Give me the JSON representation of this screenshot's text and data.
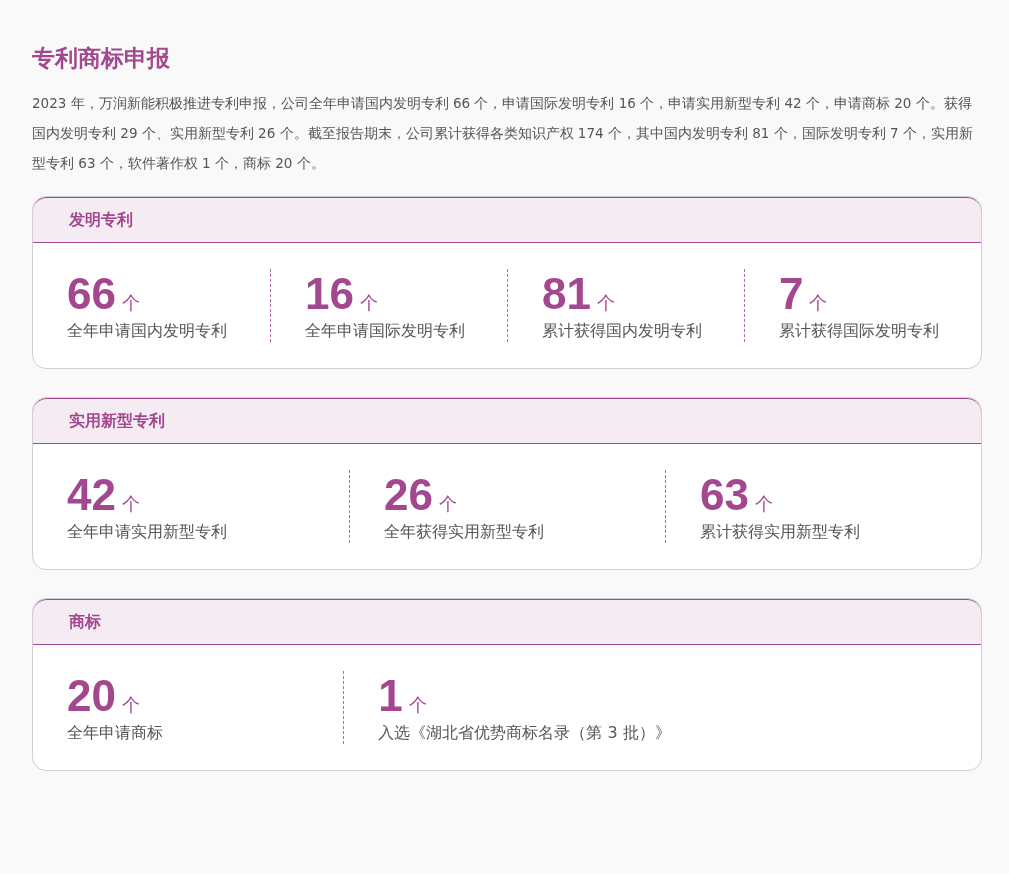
{
  "title": "专利商标申报",
  "intro": "2023 年，万润新能积极推进专利申报，公司全年申请国内发明专利 66 个，申请国际发明专利 16 个，申请实用新型专利 42 个，申请商标 20 个。获得国内发明专利 29 个、实用新型专利 26 个。截至报告期末，公司累计获得各类知识产权 174 个，其中国内发明专利 81 个，国际发明专利 7 个，实用新型专利 63 个，软件著作权 1 个，商标 20 个。",
  "sections": [
    {
      "title": "发明专利",
      "stats": [
        {
          "value": "66",
          "unit": "个",
          "label": "全年申请国内发明专利"
        },
        {
          "value": "16",
          "unit": "个",
          "label": "全年申请国际发明专利"
        },
        {
          "value": "81",
          "unit": "个",
          "label": "累计获得国内发明专利"
        },
        {
          "value": "7",
          "unit": "个",
          "label": "累计获得国际发明专利"
        }
      ]
    },
    {
      "title": "实用新型专利",
      "stats": [
        {
          "value": "42",
          "unit": "个",
          "label": "全年申请实用新型专利"
        },
        {
          "value": "26",
          "unit": "个",
          "label": "全年获得实用新型专利"
        },
        {
          "value": "63",
          "unit": "个",
          "label": "累计获得实用新型专利"
        }
      ]
    },
    {
      "title": "商标",
      "stats": [
        {
          "value": "20",
          "unit": "个",
          "label": "全年申请商标"
        },
        {
          "value": "1",
          "unit": "个",
          "label": "入选《湖北省优势商标名录（第 3 批）》"
        }
      ]
    }
  ]
}
